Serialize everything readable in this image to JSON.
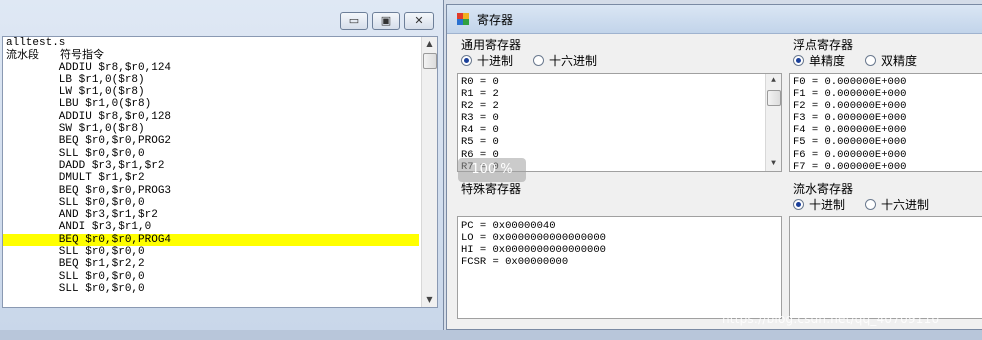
{
  "left_window": {
    "controls": {
      "minimize": "▭",
      "maximize": "▣",
      "close": "✕"
    },
    "code_header": [
      "alltest.s",
      "流水段      符号指令"
    ],
    "code_lines": [
      "        ADDIU $r8,$r0,124",
      "        LB $r1,0($r8)",
      "        LW $r1,0($r8)",
      "        LBU $r1,0($r8)",
      "        ADDIU $r8,$r0,128",
      "        SW $r1,0($r8)",
      "        BEQ $r0,$r0,PROG2",
      "        SLL $r0,$r0,0",
      "        DADD $r3,$r1,$r2",
      "        DMULT $r1,$r2",
      "        BEQ $r0,$r0,PROG3",
      "        SLL $r0,$r0,0",
      "        AND $r3,$r1,$r2",
      "        ANDI $r3,$r1,0",
      "        BEQ $r0,$r0,PROG4",
      "        SLL $r0,$r0,0",
      "        BEQ $r1,$r2,2",
      "        SLL $r0,$r0,0",
      "        SLL $r0,$r0,0"
    ],
    "highlight_index": 14,
    "highlight_color": "#ffff00"
  },
  "right_window": {
    "title": "寄存器",
    "general": {
      "label": "通用寄存器",
      "radio": [
        {
          "label": "十进制",
          "checked": true
        },
        {
          "label": "十六进制",
          "checked": false
        }
      ],
      "values": [
        "R0 = 0",
        "R1 = 2",
        "R2 = 2",
        "R3 = 0",
        "R4 = 0",
        "R5 = 0",
        "R6 = 0",
        "R7 = 0"
      ]
    },
    "float": {
      "label": "浮点寄存器",
      "radio": [
        {
          "label": "单精度",
          "checked": true
        },
        {
          "label": "双精度",
          "checked": false
        }
      ],
      "values": [
        "F0 = 0.000000E+000",
        "F1 = 0.000000E+000",
        "F2 = 0.000000E+000",
        "F3 = 0.000000E+000",
        "F4 = 0.000000E+000",
        "F5 = 0.000000E+000",
        "F6 = 0.000000E+000",
        "F7 = 0.000000E+000"
      ]
    },
    "special": {
      "label": "特殊寄存器",
      "values": [
        "PC = 0x00000040",
        "LO = 0x0000000000000000",
        "HI = 0x0000000000000000",
        "FCSR = 0x00000000"
      ]
    },
    "pipeline": {
      "label": "流水寄存器",
      "radio": [
        {
          "label": "十进制",
          "checked": true
        },
        {
          "label": "十六进制",
          "checked": false
        }
      ]
    }
  },
  "zoom_overlay": "100 %",
  "watermark": "https://blog.csdn.net/qq_40709110",
  "colors": {
    "title_gradient_top": "#dae6f4",
    "title_gradient_bottom": "#c2d4ea",
    "radio_dot": "#1a3f9a"
  }
}
